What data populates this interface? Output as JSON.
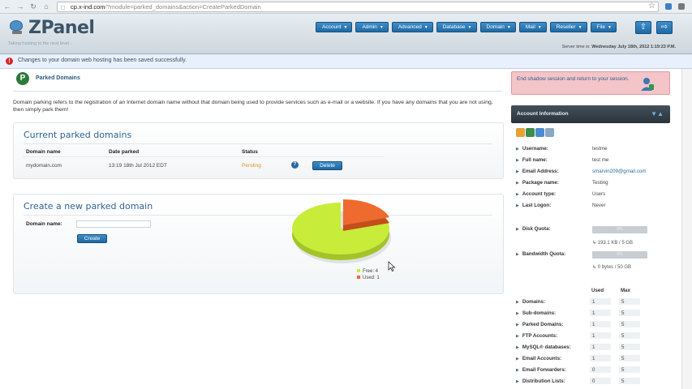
{
  "browser": {
    "url_domain": "cp.x-ind.com",
    "url_rest": "/?module=parked_domains&action=CreateParkedDomain"
  },
  "header": {
    "logo_text": "ZPanel",
    "tagline": "Taking hosting to the next level...",
    "menu": [
      "Account",
      "Admin",
      "Advanced",
      "Database",
      "Domain",
      "Mail",
      "Reseller",
      "File"
    ],
    "server_time_label": "Server time is:",
    "server_time_value": "Wednesday July 18th, 2012 1:19:23 P.M."
  },
  "notice": {
    "message": "Changes to your domain web hosting has been saved successfully."
  },
  "page": {
    "title": "Parked Domains",
    "intro": "Domain parking refers to the registration of an Internet domain name without that domain being used to provide services such as e-mail or a website. If you have any domains that you are not using, then simply park them!"
  },
  "current": {
    "title": "Current parked domains",
    "col_domain": "Domain name",
    "col_date": "Date parked",
    "col_status": "Status",
    "rows": [
      {
        "domain": "mydomain.com",
        "date": "13:19 18th Jul 2012 EDT",
        "status": "Pending",
        "action": "Delete"
      }
    ]
  },
  "create": {
    "title": "Create a new parked domain",
    "label": "Domain name:",
    "input_value": "",
    "button": "Create"
  },
  "chart_data": {
    "type": "pie",
    "categories": [
      "Free",
      "Used"
    ],
    "values": [
      4,
      1
    ],
    "colors": [
      "#c8ec3a",
      "#ef6a2f"
    ],
    "legend": [
      "Free: 4",
      "Used: 1"
    ]
  },
  "sidebar": {
    "shadow_text": "End shadow session and return to your session.",
    "account_title": "Account Information",
    "fields": [
      {
        "label": "Username:",
        "value": "testme"
      },
      {
        "label": "Full name:",
        "value": "test me"
      },
      {
        "label": "Email Address:",
        "value": "smarvin209@gmail.com"
      },
      {
        "label": "Package name:",
        "value": "Testing"
      },
      {
        "label": "Account type:",
        "value": "Users"
      },
      {
        "label": "Last Logon:",
        "value": "Never"
      }
    ],
    "disk": {
      "label": "Disk Quota:",
      "bar": "0%",
      "sub": "↳ 193.1 KB / 5 GB",
      "fill": 0
    },
    "bandwidth": {
      "label": "Bandwidth Quota:",
      "bar": "0%",
      "sub": "↳ 0 bytes / 50 GB",
      "fill": 0
    },
    "usage_used": "Used",
    "usage_max": "Max",
    "usage": [
      {
        "label": "Domains:",
        "used": "1",
        "max": "5"
      },
      {
        "label": "Sub-domains:",
        "used": "1",
        "max": "5"
      },
      {
        "label": "Parked Domains:",
        "used": "1",
        "max": "5"
      },
      {
        "label": "FTP Accounts:",
        "used": "1",
        "max": "5"
      },
      {
        "label": "MySQL® databases:",
        "used": "1",
        "max": "5"
      },
      {
        "label": "Email Accounts:",
        "used": "1",
        "max": "5"
      },
      {
        "label": "Email Forwarders:",
        "used": "0",
        "max": "5"
      },
      {
        "label": "Distribution Lists:",
        "used": "0",
        "max": "5"
      }
    ]
  }
}
